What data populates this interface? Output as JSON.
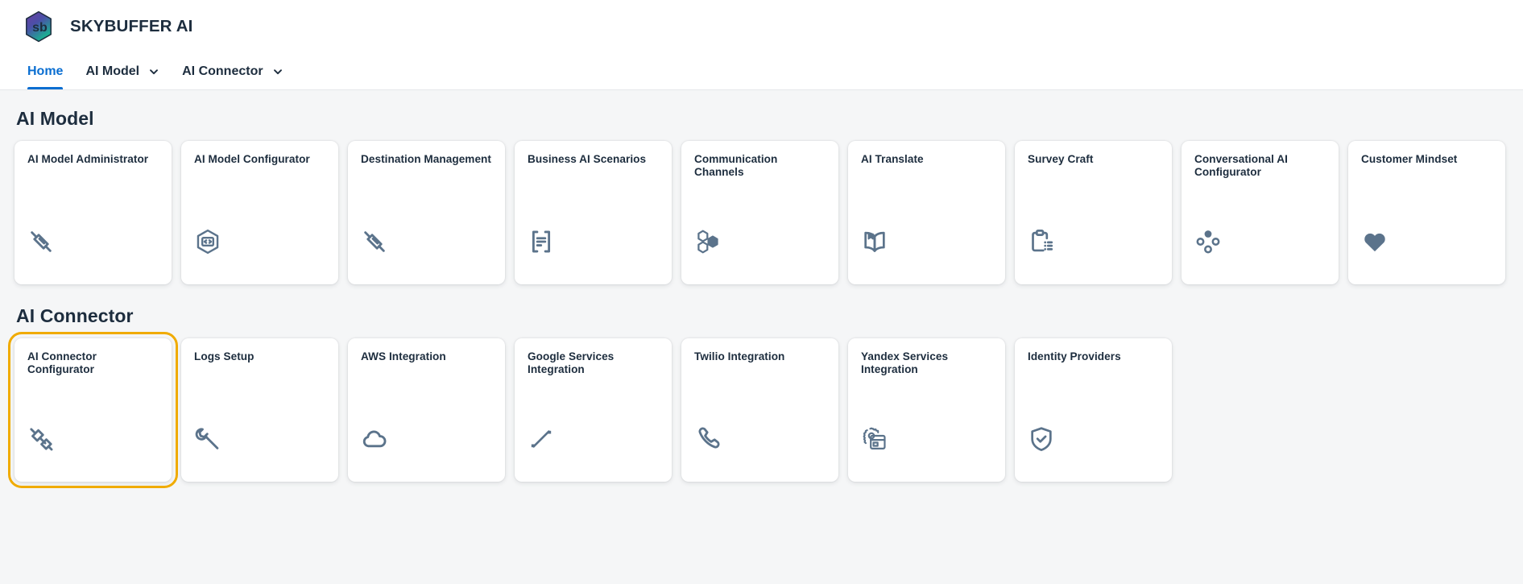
{
  "header": {
    "logo_icon": "skybuffer-hexagon-logo",
    "logo_text": "sb",
    "app_title": "SKYBUFFER AI"
  },
  "nav": {
    "items": [
      {
        "label": "Home",
        "active": true,
        "has_caret": false
      },
      {
        "label": "AI Model",
        "active": false,
        "has_caret": true,
        "caret_icon": "chevron-down-icon"
      },
      {
        "label": "AI Connector",
        "active": false,
        "has_caret": true,
        "caret_icon": "chevron-down-icon"
      }
    ]
  },
  "colors": {
    "accent_blue": "#0a6ed1",
    "focus_orange": "#f0ab00",
    "icon_gray": "#5b738b",
    "text_dark": "#1d2d3e",
    "page_bg": "#f5f6f7",
    "card_bg": "#ffffff"
  },
  "sections": [
    {
      "title": "AI Model",
      "cards": [
        {
          "title": "AI Model Administrator",
          "icon": "plug-disconnected-icon",
          "focused": false
        },
        {
          "title": "AI Model Configurator",
          "icon": "hexagon-code-icon",
          "focused": false
        },
        {
          "title": "Destination Management",
          "icon": "plug-disconnected-icon",
          "focused": false
        },
        {
          "title": "Business AI Scenarios",
          "icon": "bracketed-list-icon",
          "focused": false
        },
        {
          "title": "Communication Channels",
          "icon": "hexagon-cluster-icon",
          "focused": false
        },
        {
          "title": "AI Translate",
          "icon": "open-book-icon",
          "focused": false
        },
        {
          "title": "Survey Craft",
          "icon": "clipboard-list-icon",
          "focused": false
        },
        {
          "title": "Conversational AI Configurator",
          "icon": "four-dots-icon",
          "focused": false
        },
        {
          "title": "Customer Mindset",
          "icon": "heart-icon",
          "focused": false
        }
      ]
    },
    {
      "title": "AI Connector",
      "cards": [
        {
          "title": "AI Connector Configurator",
          "icon": "plug-disconnected-icon",
          "focused": true
        },
        {
          "title": "Logs Setup",
          "icon": "wrench-icon",
          "focused": false
        },
        {
          "title": "AWS Integration",
          "icon": "cloud-icon",
          "focused": false
        },
        {
          "title": "Google Services Integration",
          "icon": "trend-line-icon",
          "focused": false
        },
        {
          "title": "Twilio Integration",
          "icon": "phone-icon",
          "focused": false
        },
        {
          "title": "Yandex Services Integration",
          "icon": "gear-window-icon",
          "focused": false
        },
        {
          "title": "Identity Providers",
          "icon": "shield-check-icon",
          "focused": false
        }
      ]
    }
  ]
}
